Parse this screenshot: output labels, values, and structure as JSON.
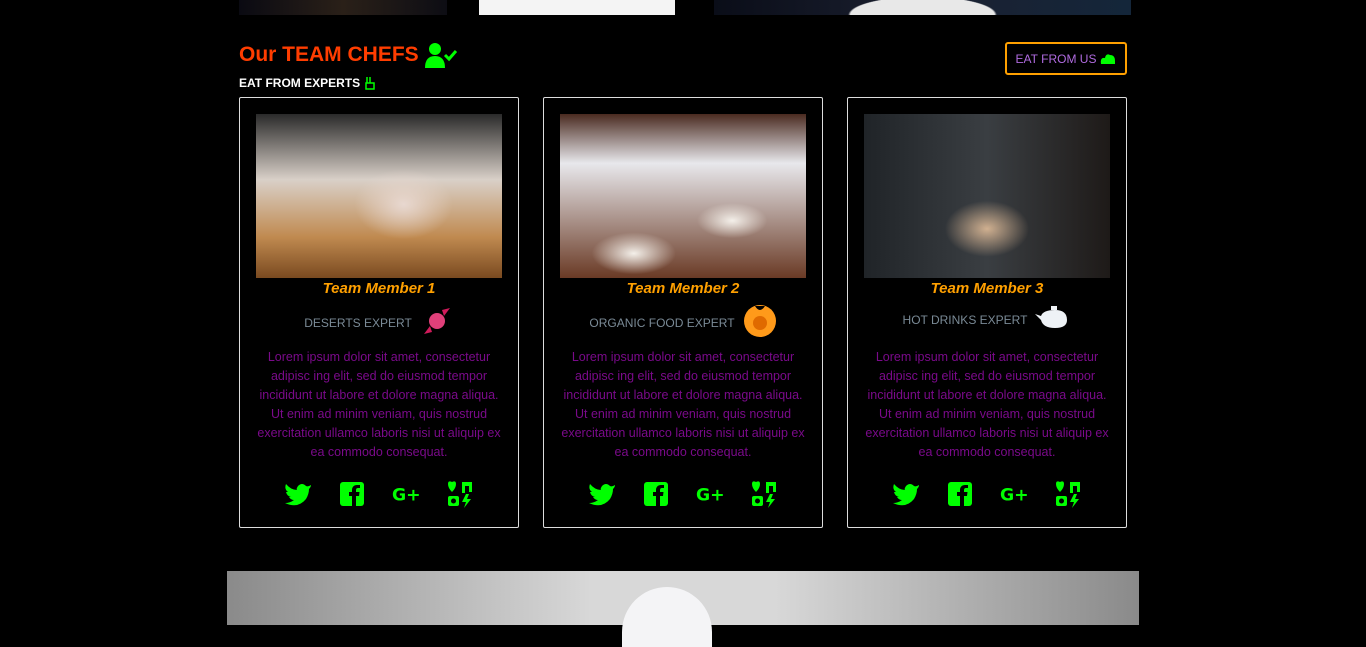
{
  "section": {
    "title": "Our TEAM CHEFS",
    "subtitle": "EAT FROM EXPERTS",
    "button": "EAT FROM US"
  },
  "colors": {
    "title": "#ff3d00",
    "accent": "#00ff00",
    "name": "#ffa000",
    "description": "#7a0a8a",
    "button_border": "#ffa000"
  },
  "members": [
    {
      "name": "Team Member 1",
      "role": "DESERTS EXPERT",
      "role_icon": "candy-icon",
      "description": "Lorem ipsum dolor sit amet, consectetur adipisc ing elit, sed do eiusmod tempor incididunt ut labore et dolore magna aliqua. Ut enim ad minim veniam, quis nostrud exercitation ullamco laboris nisi ut aliquip ex ea commodo consequat."
    },
    {
      "name": "Team Member 2",
      "role": "ORGANIC FOOD EXPERT",
      "role_icon": "orange-fruit-icon",
      "description": "Lorem ipsum dolor sit amet, consectetur adipisc ing elit, sed do eiusmod tempor incididunt ut labore et dolore magna aliqua. Ut enim ad minim veniam, quis nostrud exercitation ullamco laboris nisi ut aliquip ex ea commodo consequat."
    },
    {
      "name": "Team Member 3",
      "role": "HOT DRINKS EXPERT",
      "role_icon": "teapot-icon",
      "description": "Lorem ipsum dolor sit amet, consectetur adipisc ing elit, sed do eiusmod tempor incididunt ut labore et dolore magna aliqua. Ut enim ad minim veniam, quis nostrud exercitation ullamco laboris nisi ut aliquip ex ea commodo consequat."
    }
  ],
  "social_icons": [
    "twitter-icon",
    "facebook-icon",
    "google-plus-icon",
    "social-media-icon"
  ]
}
